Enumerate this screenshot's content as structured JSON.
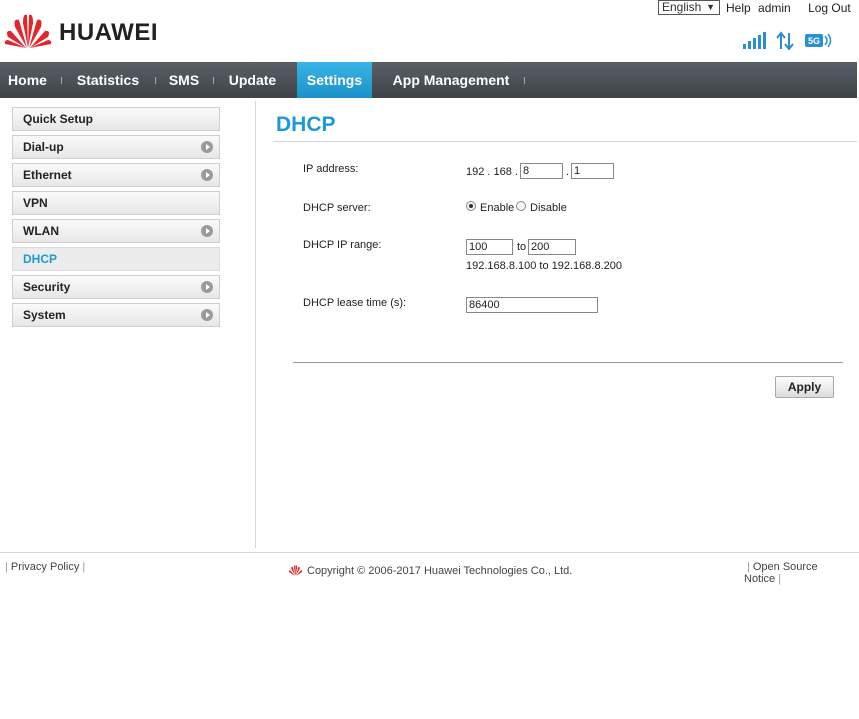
{
  "header": {
    "brand": "HUAWEI",
    "language": "English",
    "links": {
      "help": "Help",
      "user": "admin",
      "logout": "Log Out"
    },
    "status_icons": [
      "signal-icon",
      "data-transfer-icon",
      "5g-wifi-icon"
    ]
  },
  "nav": {
    "items": [
      {
        "label": "Home"
      },
      {
        "label": "Statistics"
      },
      {
        "label": "SMS"
      },
      {
        "label": "Update"
      },
      {
        "label": "Settings",
        "active": true
      },
      {
        "label": "App Management"
      }
    ]
  },
  "sidebar": {
    "items": [
      {
        "label": "Quick Setup",
        "has_arrow": false
      },
      {
        "label": "Dial-up",
        "has_arrow": true
      },
      {
        "label": "Ethernet",
        "has_arrow": true
      },
      {
        "label": "VPN",
        "has_arrow": false
      },
      {
        "label": "WLAN",
        "has_arrow": true
      },
      {
        "label": "DHCP",
        "has_arrow": false,
        "active": true
      },
      {
        "label": "Security",
        "has_arrow": true
      },
      {
        "label": "System",
        "has_arrow": true
      }
    ]
  },
  "main": {
    "title": "DHCP",
    "ip_address": {
      "label": "IP address:",
      "prefix": "192 . 168 .",
      "octet3": "8",
      "dot": ".",
      "octet4": "1"
    },
    "dhcp_server": {
      "label": "DHCP server:",
      "enable_label": "Enable",
      "disable_label": "Disable",
      "selected": "Enable"
    },
    "dhcp_range": {
      "label": "DHCP IP range:",
      "start": "100",
      "to_label": "to",
      "end": "200",
      "summary": "192.168.8.100 to 192.168.8.200"
    },
    "lease_time": {
      "label": "DHCP lease time (s):",
      "value": "86400"
    },
    "apply_label": "Apply"
  },
  "footer": {
    "privacy": "Privacy Policy",
    "copyright": "Copyright © 2006-2017 Huawei Technologies Co., Ltd.",
    "open_source": "Open Source Notice"
  },
  "colors": {
    "accent": "#1c9ad6",
    "nav_bg": "#4a5055",
    "nav_active": "#2aa5dc",
    "brand_red": "#e3262d"
  }
}
